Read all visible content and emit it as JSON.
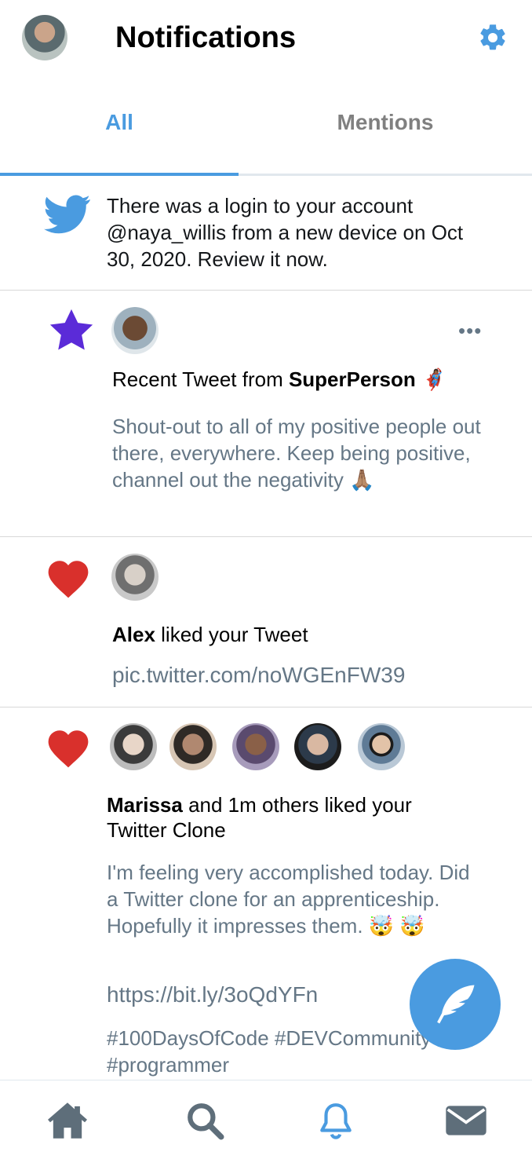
{
  "header": {
    "title": "Notifications",
    "avatar_icon": "user-avatar",
    "settings_icon": "gear-icon"
  },
  "tabs": [
    {
      "label": "All",
      "active": true
    },
    {
      "label": "Mentions",
      "active": false
    }
  ],
  "notifications": [
    {
      "type": "security",
      "icon": "twitter-bird-icon",
      "text": "There was a login to your account @naya_willis from a new device on Oct 30, 2020. Review it now."
    },
    {
      "type": "recent-tweet",
      "icon": "star-icon",
      "headline_prefix": "Recent Tweet from ",
      "author": "SuperPerson",
      "author_emoji": "🦸🏾‍♀️",
      "more": "•••",
      "body": "Shout-out to all of my positive people out there, everywhere. Keep being positive, channel out the negativity 🙏🏽"
    },
    {
      "type": "like",
      "icon": "heart-icon",
      "user": "Alex",
      "action": " liked your Tweet",
      "link": "pic.twitter.com/noWGEnFW39"
    },
    {
      "type": "like",
      "icon": "heart-icon",
      "user": "Marissa",
      "action": " and 1m others liked your Twitter Clone",
      "body": "I'm feeling very accomplished today. Did a Twitter clone for an apprenticeship. Hopefully it impresses them. 🤯 🤯",
      "link": "https://bit.ly/3oQdYFn",
      "tags": "#100DaysOfCode #DEVCommunity #programmer"
    }
  ],
  "fab": {
    "icon": "feather-compose-icon"
  },
  "bottom_nav": [
    {
      "icon": "home-icon"
    },
    {
      "icon": "search-icon"
    },
    {
      "icon": "bell-icon",
      "active": true
    },
    {
      "icon": "mail-icon"
    }
  ],
  "colors": {
    "accent": "#4a9be0",
    "heart": "#e0245e",
    "star": "#5b2bd8",
    "muted_text": "#657786",
    "nav_icon": "#5e6e7a"
  }
}
